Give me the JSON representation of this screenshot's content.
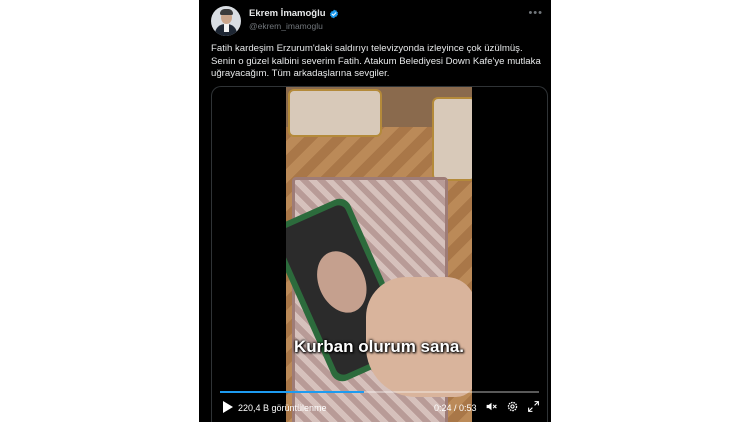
{
  "author": {
    "name": "Ekrem İmamoğlu",
    "handle": "@ekrem_imamoglu"
  },
  "tweet_text": "Fatih kardeşim Erzurum'daki saldırıyı televizyonda izleyince çok üzülmüş. Senin o güzel kalbini severim Fatih. Atakum Belediyesi Down Kafe'ye mutlaka uğrayacağım. Tüm arkadaşlarına sevgiler.",
  "video": {
    "subtitle": "Kurban olurum sana.",
    "views": "220,4 B görüntülenme",
    "time": "0:24 / 0:53",
    "progress_fraction": 0.4528
  },
  "colors": {
    "accent": "#1d9bf0",
    "background": "#000000",
    "text": "#e7e9ea",
    "muted": "#71767b"
  },
  "icons": [
    "verified-badge-icon",
    "more-icon",
    "play-icon",
    "volume-icon",
    "settings-icon",
    "fullscreen-icon"
  ]
}
